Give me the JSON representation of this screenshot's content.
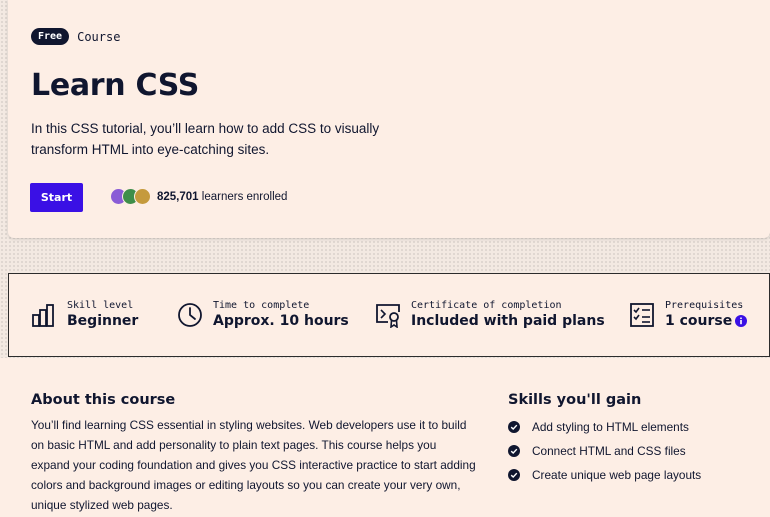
{
  "hero": {
    "badge": "Free",
    "type": "Course",
    "title": "Learn CSS",
    "description": "In this CSS tutorial, you’ll learn how to add CSS to visually transform HTML into eye-catching sites.",
    "start_label": "Start",
    "enrolled_count": "825,701",
    "enrolled_suffix": " learners enrolled"
  },
  "stats": [
    {
      "icon": "bar-chart-icon",
      "label": "Skill level",
      "value": "Beginner"
    },
    {
      "icon": "clock-icon",
      "label": "Time to complete",
      "value": "Approx. 10 hours"
    },
    {
      "icon": "certificate-icon",
      "label": "Certificate of completion",
      "value": "Included with paid plans"
    },
    {
      "icon": "checklist-icon",
      "label": "Prerequisites",
      "value": "1 course"
    }
  ],
  "about": {
    "title": "About this course",
    "text": "You’ll find learning CSS essential in styling websites. Web developers use it to build on basic HTML and add personality to plain text pages. This course helps you expand your coding foundation and gives you CSS interactive practice to start adding colors and background images or editing layouts so you can create your very own, unique stylized web pages."
  },
  "skills": {
    "title": "Skills you'll gain",
    "items": [
      "Add styling to HTML elements",
      "Connect HTML and CSS files",
      "Create unique web page layouts"
    ]
  },
  "colors": {
    "accent": "#3a10e5",
    "text": "#10162f",
    "card_bg": "#fdeee5",
    "page_bg": "#f3e9e2"
  }
}
